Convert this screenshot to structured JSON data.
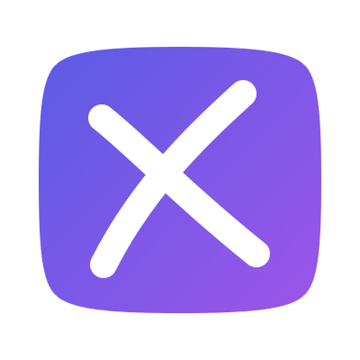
{
  "icon": {
    "name": "close-x-icon",
    "gradient_start": "#5B5CE6",
    "gradient_end": "#9A55E8",
    "glyph_color": "#FFFFFF",
    "background": "#FFFFFF"
  }
}
